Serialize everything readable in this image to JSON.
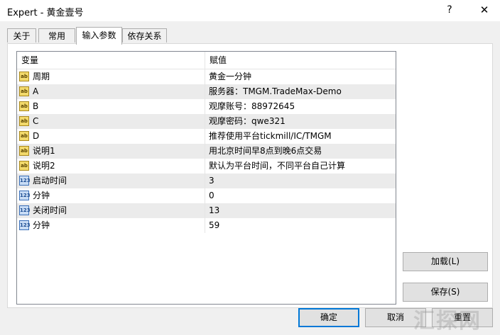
{
  "window": {
    "title": "Expert - 黄金壹号",
    "help": "?",
    "close": "✕"
  },
  "tabs": [
    {
      "label": "关于"
    },
    {
      "label": "常用"
    },
    {
      "label": "输入参数"
    },
    {
      "label": "依存关系"
    }
  ],
  "grid": {
    "columns": {
      "variable": "变量",
      "value": "赋值"
    },
    "rows": [
      {
        "icon": "ab",
        "name": "周期",
        "value": "黄金一分钟"
      },
      {
        "icon": "ab",
        "name": "A",
        "value": "服务器：TMGM.TradeMax-Demo"
      },
      {
        "icon": "ab",
        "name": "B",
        "value": "观摩账号：88972645"
      },
      {
        "icon": "ab",
        "name": "C",
        "value": "观摩密码：qwe321"
      },
      {
        "icon": "ab",
        "name": "D",
        "value": "推荐使用平台tickmill/IC/TMGM"
      },
      {
        "icon": "ab",
        "name": "说明1",
        "value": "用北京时间早8点到晚6点交易"
      },
      {
        "icon": "ab",
        "name": "说明2",
        "value": "默认为平台时间，不同平台自己计算"
      },
      {
        "icon": "123",
        "name": "启动时间",
        "value": "3"
      },
      {
        "icon": "123",
        "name": "分钟",
        "value": "0"
      },
      {
        "icon": "123",
        "name": "关闭时间",
        "value": "13"
      },
      {
        "icon": "123",
        "name": "分钟",
        "value": "59"
      }
    ]
  },
  "buttons": {
    "load": "加载(L)",
    "save": "保存(S)",
    "ok": "确定",
    "cancel": "取消",
    "reset": "重置"
  },
  "watermark": "汇探网"
}
